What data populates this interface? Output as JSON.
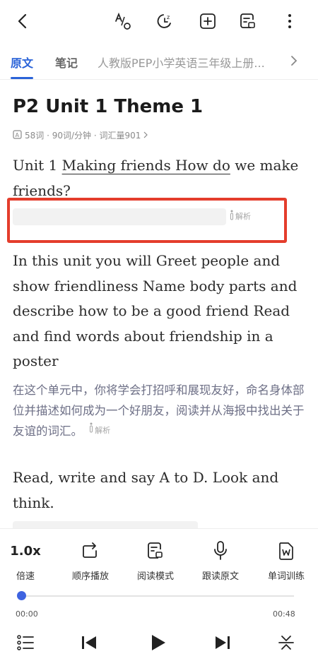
{
  "header": {
    "icons": [
      "back-icon",
      "translate-icon",
      "timer-icon",
      "add-icon",
      "reading-mode-icon",
      "more-icon"
    ]
  },
  "tabs": {
    "original": "原文",
    "notes": "笔记",
    "book": "人教版PEP小学英语三年级上册..."
  },
  "article": {
    "title": "P2 Unit 1 Theme 1",
    "meta": "58词 · 90词/分钟 · 词汇量901",
    "p1_pre": "Unit 1 ",
    "p1_underlined": "Making friends How do",
    "p1_post": " we make friends?",
    "jiexi": "解析",
    "p2": "In this unit you will Greet people and show friendliness Name body parts and describe how to be a good friend Read and find words about friendship in a poster",
    "p2_translation": "在这个单元中，你将学会打招呼和展现友好，命名身体部位并描述如何成为一个好朋友，阅读并从海报中找出关于友谊的词汇。",
    "p3": "Read, write and say A to D. Look and think."
  },
  "player": {
    "speed_value": "1.0x",
    "speed_label": "倍速",
    "order_label": "顺序播放",
    "reading_label": "阅读模式",
    "follow_label": "跟读原文",
    "word_label": "单词训练",
    "time_current": "00:00",
    "time_total": "00:48",
    "progress": 0,
    "accent": "#3e63e0"
  }
}
